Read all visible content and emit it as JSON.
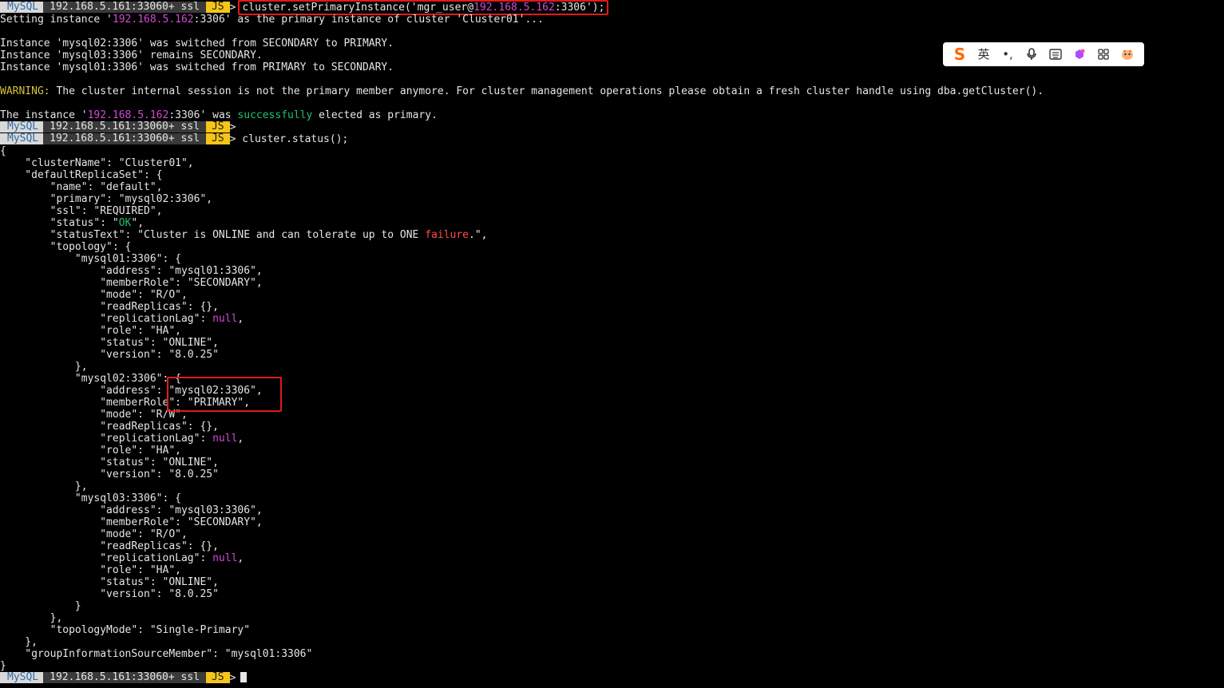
{
  "prompt": {
    "product": "MySQL",
    "host": "192.168.5.161:33060+ ssl",
    "mode": "JS",
    "arrow": ">"
  },
  "colors": {
    "command_highlight": "#e01b1b",
    "ip_magenta": "#d44ad4",
    "success_green": "#1fc36e",
    "warning_yellow": "#d6c23a",
    "js_badge": "#f5c518"
  },
  "command1": {
    "before": "cluster.setPrimaryInstance('mgr_user@",
    "ip": "192.168.5.162",
    "after": ":3306');"
  },
  "setting_line": {
    "before": "Setting instance '",
    "ip": "192.168.5.162",
    "after": ":3306' as the primary instance of cluster 'Cluster01'..."
  },
  "switch_lines": [
    "Instance 'mysql02:3306' was switched from SECONDARY to PRIMARY.",
    "Instance 'mysql03:3306' remains SECONDARY.",
    "Instance 'mysql01:3306' was switched from PRIMARY to SECONDARY."
  ],
  "warning": {
    "label": "WARNING:",
    "text": " The cluster internal session is not the primary member anymore. For cluster management operations please obtain a fresh cluster handle using dba.getCluster()."
  },
  "elected_line": {
    "before": "The instance '",
    "ip": "192.168.5.162",
    "middle": ":3306' was ",
    "success": "successfully",
    "after": " elected as primary."
  },
  "command2": "cluster.status();",
  "status_json": {
    "open": "{",
    "cluster_name": "    \"clusterName\": \"Cluster01\",",
    "default_replica_set": "    \"defaultReplicaSet\": {",
    "name": "        \"name\": \"default\",",
    "primary": "        \"primary\": \"mysql02:3306\",",
    "ssl": "        \"ssl\": \"REQUIRED\",",
    "status_before": "        \"status\": \"",
    "status_ok": "OK",
    "status_after": "\",",
    "status_text_before": "        \"statusText\": \"Cluster is ONLINE and can tolerate up to ONE ",
    "status_text_failure": "failure",
    "status_text_after": ".\",",
    "topology_open": "        \"topology\": {",
    "members": [
      {
        "key_line": "            \"mysql01:3306\": {",
        "address": "                \"address\": \"mysql01:3306\",",
        "member_role": "                \"memberRole\": \"SECONDARY\",",
        "mode": "                \"mode\": \"R/O\",",
        "read_replicas": "                \"readReplicas\": {},",
        "replication_lag_before": "                \"replicationLag\": ",
        "replication_lag_null": "null",
        "replication_lag_after": ",",
        "role": "                \"role\": \"HA\",",
        "status": "                \"status\": \"ONLINE\",",
        "version": "                \"version\": \"8.0.25\"",
        "close": "            },"
      },
      {
        "key_line": "            \"mysql02:3306\": {",
        "address": "                \"address\": \"mysql02:3306\",",
        "member_role": "                \"memberRole\": \"PRIMARY\",",
        "mode": "                \"mode\": \"R/W\",",
        "read_replicas": "                \"readReplicas\": {},",
        "replication_lag_before": "                \"replicationLag\": ",
        "replication_lag_null": "null",
        "replication_lag_after": ",",
        "role": "                \"role\": \"HA\",",
        "status": "                \"status\": \"ONLINE\",",
        "version": "                \"version\": \"8.0.25\"",
        "close": "            },"
      },
      {
        "key_line": "            \"mysql03:3306\": {",
        "address": "                \"address\": \"mysql03:3306\",",
        "member_role": "                \"memberRole\": \"SECONDARY\",",
        "mode": "                \"mode\": \"R/O\",",
        "read_replicas": "                \"readReplicas\": {},",
        "replication_lag_before": "                \"replicationLag\": ",
        "replication_lag_null": "null",
        "replication_lag_after": ",",
        "role": "                \"role\": \"HA\",",
        "status": "                \"status\": \"ONLINE\",",
        "version": "                \"version\": \"8.0.25\"",
        "close": "            }"
      }
    ],
    "topology_close": "        },",
    "topology_mode": "        \"topologyMode\": \"Single-Primary\"",
    "replica_set_close": "    },",
    "group_info": "    \"groupInformationSourceMember\": \"mysql01:3306\"",
    "close": "}"
  },
  "ime_toolbar": {
    "logo": "S",
    "lang": "英",
    "punct": "•,",
    "icons": [
      "sogou-logo-icon",
      "language-toggle-icon",
      "punctuation-icon",
      "microphone-icon",
      "keyboard-icon",
      "skin-icon",
      "apps-grid-icon",
      "mascot-icon"
    ]
  }
}
